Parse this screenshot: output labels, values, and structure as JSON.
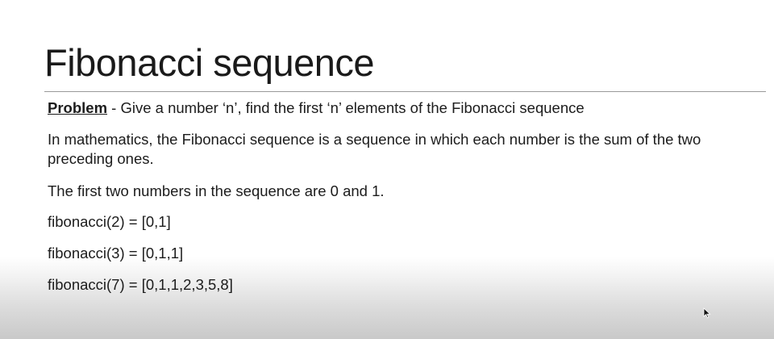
{
  "slide": {
    "title": "Fibonacci sequence",
    "problem": {
      "label": "Problem",
      "text": " - Give a number ‘n’, find the first ‘n’ elements of the Fibonacci sequence"
    },
    "intro": "In mathematics, the Fibonacci sequence is a sequence in which each number is the sum of the two preceding ones.",
    "first_two": "The first two numbers in the sequence are 0 and 1.",
    "examples": [
      "fibonacci(2) = [0,1]",
      "fibonacci(3) = [0,1,1]",
      "fibonacci(7) = [0,1,1,2,3,5,8]"
    ]
  },
  "icons": {
    "cursor": "mouse-pointer-icon"
  }
}
